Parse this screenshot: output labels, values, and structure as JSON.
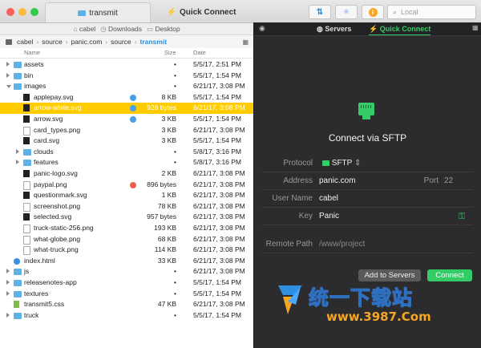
{
  "titlebar": {
    "tab_transmit": "transmit",
    "tab_quick_connect": "Quick Connect",
    "search_placeholder": "Local"
  },
  "favorites": [
    "cabel",
    "Downloads",
    "Desktop"
  ],
  "path": {
    "segments": [
      "cabel",
      "source",
      "panic.com",
      "source"
    ],
    "current": "transmit"
  },
  "columns": {
    "name": "Name",
    "size": "Size",
    "date": "Date"
  },
  "files": [
    {
      "name": "assets",
      "size": "•",
      "date": "5/5/17, 2:51 PM"
    },
    {
      "name": "bin",
      "size": "•",
      "date": "5/5/17, 1:54 PM"
    },
    {
      "name": "images",
      "size": "•",
      "date": "6/21/17, 3:08 PM"
    },
    {
      "name": "applepay.svg",
      "size": "8 KB",
      "date": "5/5/17, 1:54 PM"
    },
    {
      "name": "arrow-white.svg",
      "size": "928 bytes",
      "date": "6/21/17, 3:08 PM"
    },
    {
      "name": "arrow.svg",
      "size": "3 KB",
      "date": "5/5/17, 1:54 PM"
    },
    {
      "name": "card_types.png",
      "size": "3 KB",
      "date": "6/21/17, 3:08 PM"
    },
    {
      "name": "card.svg",
      "size": "3 KB",
      "date": "5/5/17, 1:54 PM"
    },
    {
      "name": "clouds",
      "size": "•",
      "date": "5/8/17, 3:16 PM"
    },
    {
      "name": "features",
      "size": "•",
      "date": "5/8/17, 3:16 PM"
    },
    {
      "name": "panic-logo.svg",
      "size": "2 KB",
      "date": "6/21/17, 3:08 PM"
    },
    {
      "name": "paypal.png",
      "size": "896 bytes",
      "date": "6/21/17, 3:08 PM"
    },
    {
      "name": "questionmark.svg",
      "size": "1 KB",
      "date": "6/21/17, 3:08 PM"
    },
    {
      "name": "screenshot.png",
      "size": "78 KB",
      "date": "6/21/17, 3:08 PM"
    },
    {
      "name": "selected.svg",
      "size": "957 bytes",
      "date": "6/21/17, 3:08 PM"
    },
    {
      "name": "truck-static-256.png",
      "size": "193 KB",
      "date": "6/21/17, 3:08 PM"
    },
    {
      "name": "what-globe.png",
      "size": "68 KB",
      "date": "6/21/17, 3:08 PM"
    },
    {
      "name": "what-truck.png",
      "size": "114 KB",
      "date": "6/21/17, 3:08 PM"
    },
    {
      "name": "index.html",
      "size": "33 KB",
      "date": "6/21/17, 3:08 PM"
    },
    {
      "name": "js",
      "size": "•",
      "date": "6/21/17, 3:08 PM"
    },
    {
      "name": "releasenotes-app",
      "size": "•",
      "date": "5/5/17, 1:54 PM"
    },
    {
      "name": "textures",
      "size": "•",
      "date": "5/5/17, 1:54 PM"
    },
    {
      "name": "transmit5.css",
      "size": "47 KB",
      "date": "6/21/17, 3:08 PM"
    },
    {
      "name": "truck",
      "size": "•",
      "date": "5/5/17, 1:54 PM"
    }
  ],
  "right": {
    "tab_servers": "Servers",
    "tab_quick_connect": "Quick Connect",
    "heading": "Connect via SFTP",
    "protocol_label": "Protocol",
    "protocol_value": "SFTP",
    "address_label": "Address",
    "address_value": "panic.com",
    "port_label": "Port",
    "port_value": "22",
    "user_label": "User Name",
    "user_value": "cabel",
    "key_label": "Key",
    "key_value": "Panic",
    "remote_label": "Remote Path",
    "remote_placeholder": "/www/project",
    "add_button": "Add to Servers",
    "connect_button": "Connect"
  },
  "watermark": {
    "text": "统一下载站",
    "url": "www.3987.Com"
  },
  "colors": {
    "selection": "#ffcc00",
    "accent_green": "#33cc66",
    "tag_blue": "#4a9fe8",
    "tag_red": "#e8604a",
    "folder_blue": "#5db3e8"
  }
}
